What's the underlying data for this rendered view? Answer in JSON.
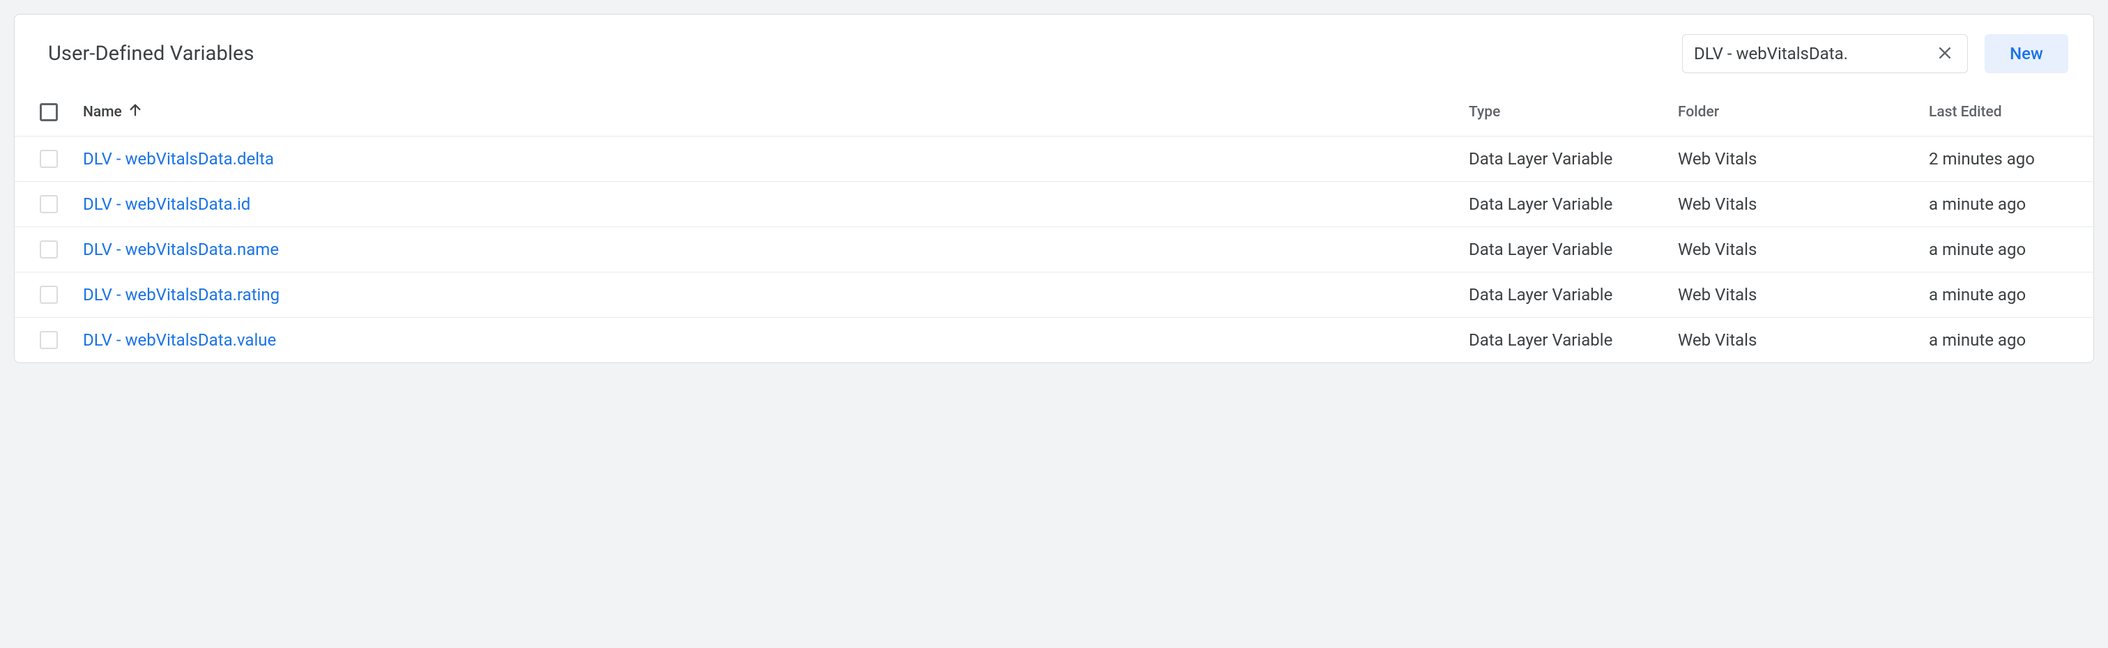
{
  "header": {
    "title": "User-Defined Variables",
    "search_value": "DLV - webVitalsData.",
    "new_label": "New"
  },
  "columns": {
    "name": "Name",
    "type": "Type",
    "folder": "Folder",
    "last_edited": "Last Edited",
    "sort_column": "name",
    "sort_dir": "asc"
  },
  "rows": [
    {
      "name": "DLV - webVitalsData.delta",
      "type": "Data Layer Variable",
      "folder": "Web Vitals",
      "last_edited": "2 minutes ago"
    },
    {
      "name": "DLV - webVitalsData.id",
      "type": "Data Layer Variable",
      "folder": "Web Vitals",
      "last_edited": "a minute ago"
    },
    {
      "name": "DLV - webVitalsData.name",
      "type": "Data Layer Variable",
      "folder": "Web Vitals",
      "last_edited": "a minute ago"
    },
    {
      "name": "DLV - webVitalsData.rating",
      "type": "Data Layer Variable",
      "folder": "Web Vitals",
      "last_edited": "a minute ago"
    },
    {
      "name": "DLV - webVitalsData.value",
      "type": "Data Layer Variable",
      "folder": "Web Vitals",
      "last_edited": "a minute ago"
    }
  ]
}
